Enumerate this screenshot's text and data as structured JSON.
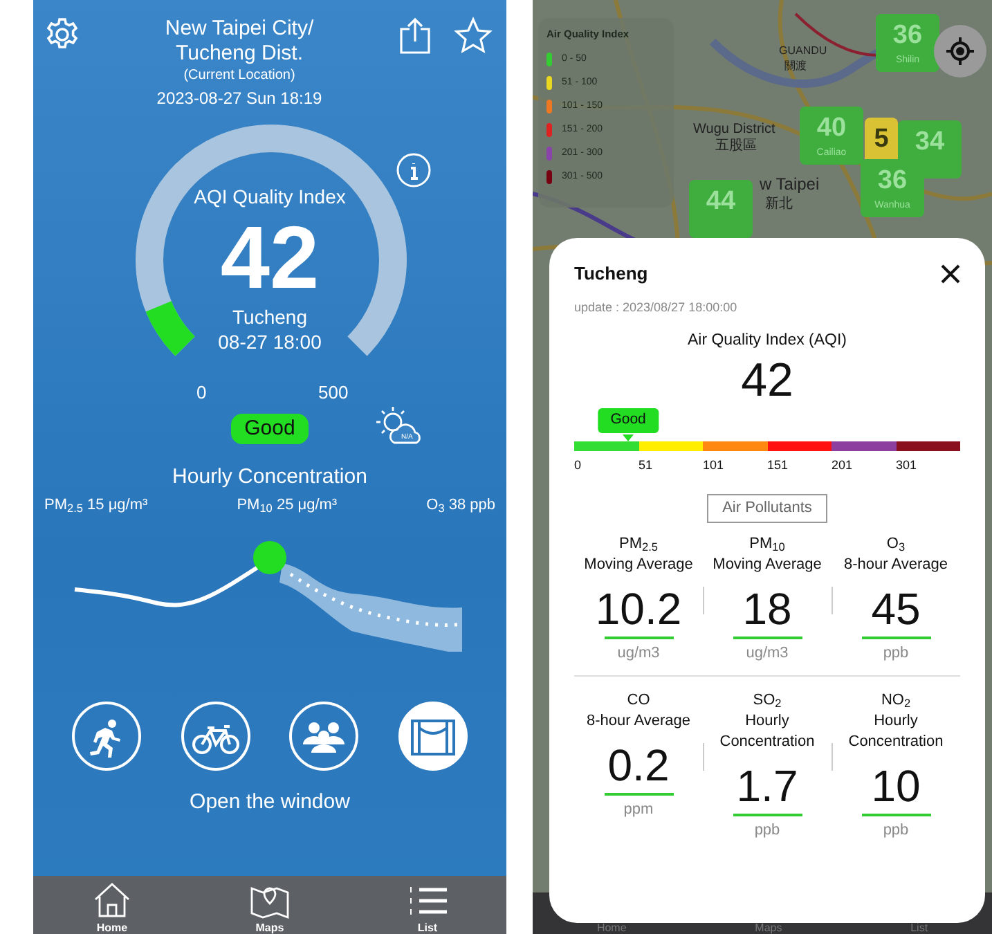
{
  "home_screen": {
    "title_lines": [
      "New Taipei City/",
      "Tucheng Dist."
    ],
    "location_note": "(Current Location)",
    "datetime": "2023-08-27 Sun 18:19",
    "gauge": {
      "title": "AQI Quality Index",
      "value": "42",
      "station": "Tucheng",
      "time": "08-27 18:00",
      "min": "0",
      "max": "500",
      "level": 0.084,
      "color": "#22dd22"
    },
    "status": "Good",
    "weather_badge": "N/A",
    "hourly": {
      "title": "Hourly Concentration",
      "readings": [
        "PM$_{2.5}$ 15 μg/m³",
        "PM$_{10}$ 25 μg/m³",
        "O$_{3}$ 38 ppb"
      ]
    },
    "activities": [
      {
        "kind": "running",
        "selected": false
      },
      {
        "kind": "cycling",
        "selected": false
      },
      {
        "kind": "group",
        "selected": false
      },
      {
        "kind": "window",
        "selected": true
      }
    ],
    "advice": "Open the window",
    "nav": [
      {
        "kind": "home",
        "label": "Home"
      },
      {
        "kind": "map",
        "label": "Maps"
      },
      {
        "kind": "list",
        "label": "List"
      }
    ]
  },
  "map_screen": {
    "legend": {
      "title": "Air Quality Index",
      "ranges": [
        {
          "label": "0 - 50",
          "color": "#33cc33"
        },
        {
          "label": "51 - 100",
          "color": "#e8d820"
        },
        {
          "label": "101 - 150",
          "color": "#ee7722"
        },
        {
          "label": "151 - 200",
          "color": "#dd2222"
        },
        {
          "label": "201 - 300",
          "color": "#8844aa"
        },
        {
          "label": "301 - 500",
          "color": "#770011"
        }
      ]
    },
    "places": [
      "GUANDU",
      "關渡",
      "Wugu District",
      "五股區",
      "w Taipei",
      "新北"
    ],
    "markers": [
      {
        "value": "36",
        "name": "Shilin",
        "color": "#3fae3f"
      },
      {
        "value": "40",
        "name": "Cailiao",
        "color": "#3fae3f"
      },
      {
        "value": "5",
        "color": "#d9c233"
      },
      {
        "value": "34",
        "color": "#3fae3f"
      },
      {
        "value": "44",
        "color": "#3fae3f"
      },
      {
        "value": "36",
        "name": "Wanhua",
        "color": "#3fae3f"
      }
    ],
    "detail": {
      "station": "Tucheng",
      "update": "update : 2023/08/27 18:00:00",
      "title": "Air Quality Index (AQI)",
      "value": "42",
      "status": "Good",
      "level": 0.14,
      "scale": [
        {
          "label": "0",
          "color": "#33dd33"
        },
        {
          "label": "51",
          "color": "#ffee00"
        },
        {
          "label": "101",
          "color": "#ff8811"
        },
        {
          "label": "151",
          "color": "#ff1111"
        },
        {
          "label": "201",
          "color": "#8d3fa0"
        },
        {
          "label": "301",
          "color": "#8a1020"
        }
      ],
      "pollutants_button": "Air Pollutants",
      "pollutants": [
        {
          "name": "PM$_{2.5}$",
          "period": "Moving Average",
          "value": "10.2",
          "unit": "ug/m3"
        },
        {
          "name": "PM$_{10}$",
          "period": "Moving Average",
          "value": "18",
          "unit": "ug/m3"
        },
        {
          "name": "O$_{3}$",
          "period": "8-hour Average",
          "value": "45",
          "unit": "ppb"
        },
        {
          "name": "CO",
          "period": "8-hour Average",
          "value": "0.2",
          "unit": "ppm"
        },
        {
          "name": "SO$_{2}$",
          "period": "Hourly Concentration",
          "value": "1.7",
          "unit": "ppb"
        },
        {
          "name": "NO$_{2}$",
          "period": "Hourly Concentration",
          "value": "10",
          "unit": "ppb"
        }
      ]
    },
    "nav": [
      "Home",
      "Maps",
      "List"
    ]
  }
}
